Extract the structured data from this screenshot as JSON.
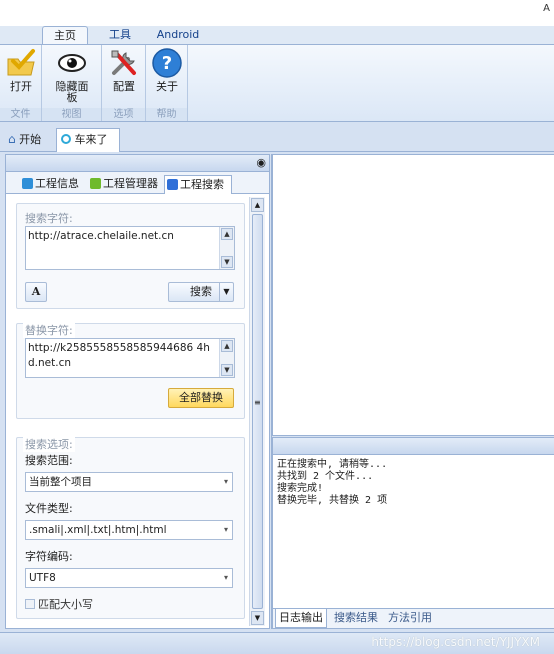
{
  "titlebar": {
    "corner": "A"
  },
  "ribbon": {
    "tabs": [
      "主页",
      "工具",
      "Android"
    ],
    "buttons": {
      "open": "打开",
      "hide_panel_line1": "隐藏面",
      "hide_panel_line2": "板",
      "config": "配置",
      "about": "关于"
    },
    "groups": [
      "文件",
      "视图",
      "选项",
      "帮助"
    ]
  },
  "doc_tabs": [
    "开始",
    "车来了"
  ],
  "left_panel": {
    "tabs": [
      "工程信息",
      "工程管理器",
      "工程搜索"
    ],
    "search": {
      "title": "搜索字符:",
      "value": "http://atrace.chelaile.net.cn",
      "search_button": "搜索"
    },
    "replace": {
      "title": "替换字符:",
      "value": "http://k2585558558585944686 4hd.net.cn",
      "replace_all_button": "全部替换"
    },
    "options": {
      "title": "搜索选项:",
      "scope_label": "搜索范围:",
      "scope_value": "当前整个项目",
      "type_label": "文件类型:",
      "type_value": ".smali|.xml|.txt|.htm|.html",
      "encoding_label": "字符编码:",
      "encoding_value": "UTF8",
      "match_case": "匹配大小写"
    }
  },
  "output": {
    "lines": [
      "正在搜索中, 请稍等...",
      "共找到 2 个文件...",
      "搜索完成!",
      "替换完毕, 共替换 2 项"
    ],
    "tabs": [
      "日志输出",
      "搜索结果",
      "方法引用"
    ]
  },
  "watermark": "https://blog.csdn.net/YJJYXM",
  "colors": {
    "accent": "#15428b",
    "ribbon_border": "#9ab2d5",
    "button_highlight": "#ffd85e"
  }
}
